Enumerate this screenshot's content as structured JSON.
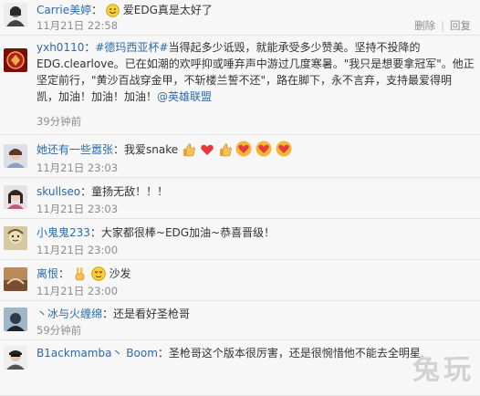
{
  "comments": [
    {
      "user": "Carrie美婷",
      "text": "爱EDG真是太好了",
      "time": "11月21日 22:58",
      "has_actions": true
    },
    {
      "user": "yxh0110",
      "text_lines": [
        [
          "#德玛西亚杯#",
          "当得起多少诋毁，就能承受多少赞美。坚持不投降的"
        ],
        "EDG.clearlove。已在如潮的欢呼抑或唾弃声中游过几度寒暑。\"我只是想要拿冠军\"。他正",
        "坚定前行，\"黄沙百战穿金甲，不斩楼兰誓不还\"，路在脚下，永不言弃，支持最爱得明",
        [
          "凯，加油！加油！加油！",
          "@英雄联盟"
        ]
      ],
      "time": "39分钟前"
    },
    {
      "user": "她还有一些嚣张",
      "text": "我爱snake",
      "time": "11月21日 23:03"
    },
    {
      "user": "skullseo",
      "text": "童扬无敌！！！",
      "time": "11月21日 23:03"
    },
    {
      "user": "小鬼鬼233",
      "text": "大家都很棒~EDG加油~恭喜晋级！",
      "time": "11月21日 23:00"
    },
    {
      "user": "离恨",
      "text": "沙发",
      "time": "11月21日 23:00"
    },
    {
      "user": "丶冰与火缠绵",
      "text": "还是看好圣枪哥",
      "time": "59分钟前"
    },
    {
      "user": "B1ackmamba丶 Boom",
      "text": "圣枪哥这个版本很厉害，还是很惋惜他不能去全明星",
      "time": ""
    }
  ],
  "actions": {
    "delete": "删除",
    "reply": "回复"
  },
  "watermark": "兔玩",
  "colors": {
    "link": "#2d6aa8",
    "meta": "#8d8d8d",
    "bg": "#f7f7f7"
  }
}
